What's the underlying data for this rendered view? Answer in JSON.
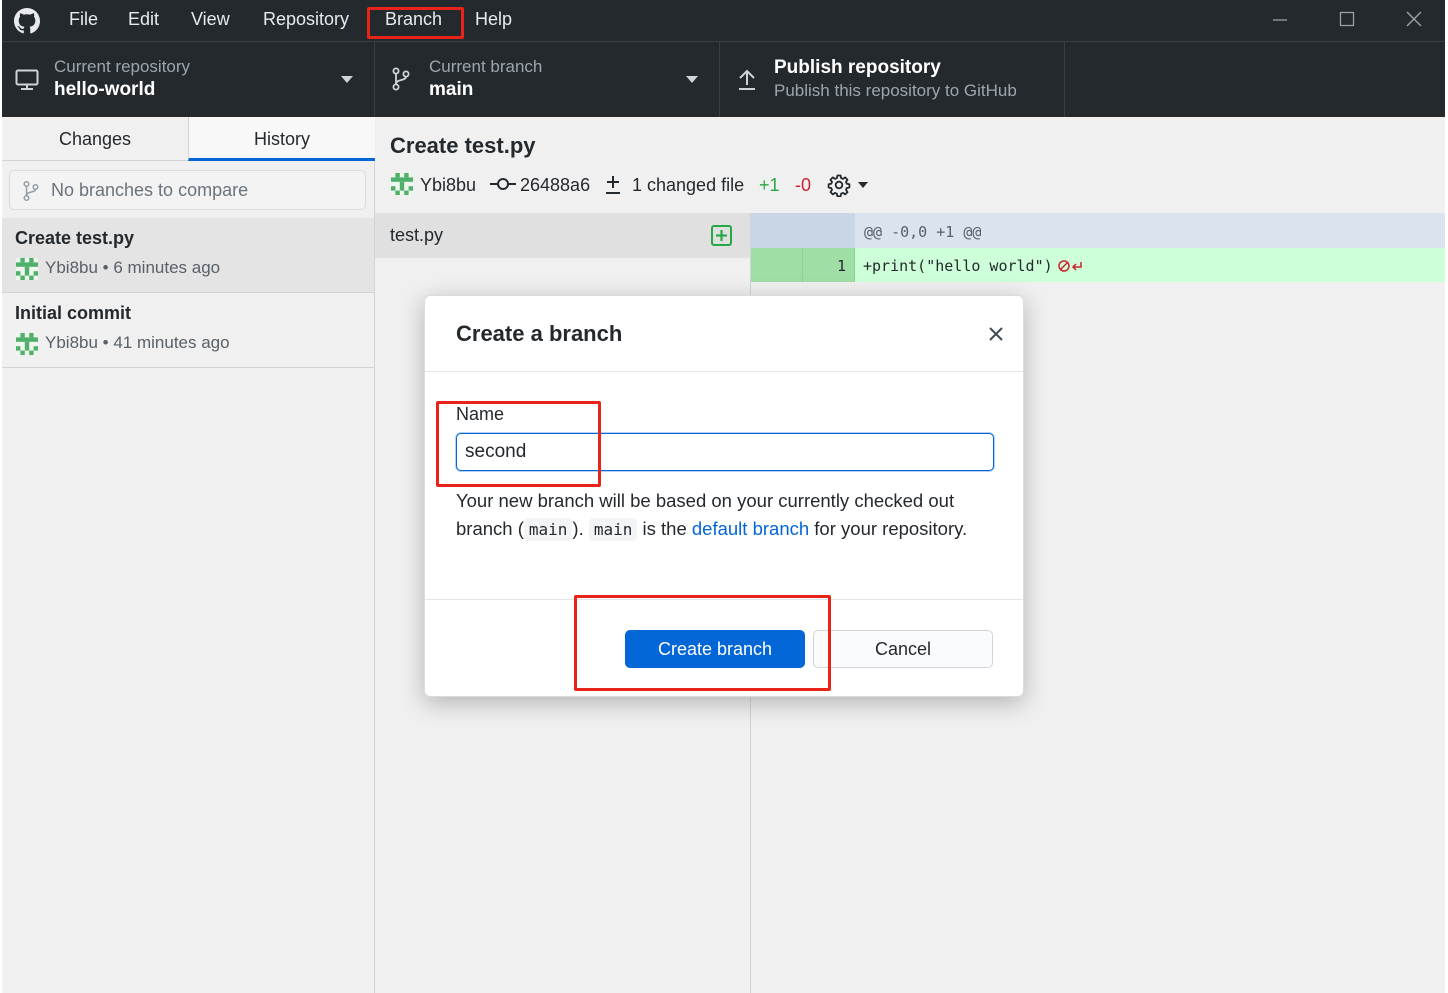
{
  "menu": [
    "File",
    "Edit",
    "View",
    "Repository",
    "Branch",
    "Help"
  ],
  "toolbar": {
    "repo_label": "Current repository",
    "repo_name": "hello-world",
    "branch_label": "Current branch",
    "branch_name": "main",
    "publish_title": "Publish repository",
    "publish_desc": "Publish this repository to GitHub"
  },
  "sidebar": {
    "tabs": [
      "Changes",
      "History"
    ],
    "active_tab": "History",
    "compare_placeholder": "No branches to compare",
    "commits": [
      {
        "title": "Create test.py",
        "author": "Ybi8bu",
        "time": "6 minutes ago"
      },
      {
        "title": "Initial commit",
        "author": "Ybi8bu",
        "time": "41 minutes ago"
      }
    ]
  },
  "commit": {
    "title": "Create test.py",
    "author": "Ybi8bu",
    "sha": "26488a6",
    "changed": "1 changed file",
    "additions": "+1",
    "deletions": "-0"
  },
  "files": [
    {
      "name": "test.py",
      "status": "added"
    }
  ],
  "diff": {
    "hunk": "@@ -0,0 +1 @@",
    "line_number": "1",
    "line": "+print(\"hello world\")"
  },
  "modal": {
    "title": "Create a branch",
    "name_label": "Name",
    "name_value": "second",
    "desc_1": "Your new branch will be based on your currently checked out branch (",
    "code_1": "main",
    "desc_2": "). ",
    "code_2": "main",
    "desc_3": " is the ",
    "link": "default branch",
    "desc_4": " for your repository.",
    "create_label": "Create branch",
    "cancel_label": "Cancel"
  },
  "colors": {
    "titlebar": "#24292e",
    "accent": "#0366d6",
    "added_bg": "#cdffd8",
    "highlight": "#e8231a"
  }
}
